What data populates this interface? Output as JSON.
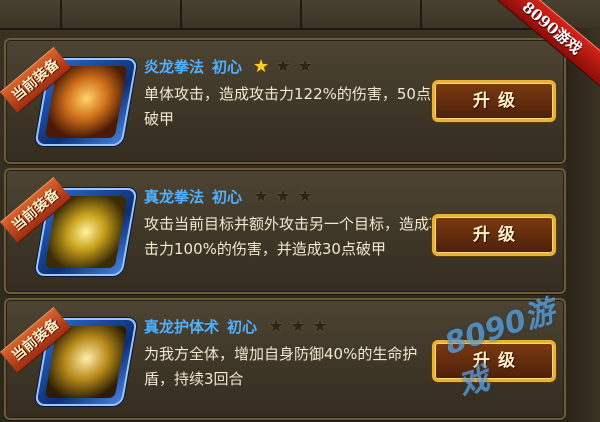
{
  "corner_banner": "8090游戏",
  "watermark": "8090游戏",
  "cards": [
    {
      "ribbon": "当前装备",
      "skill_name": "炎龙拳法",
      "grade": "初心",
      "stars_lit": 1,
      "stars_total": 3,
      "description": "单体攻击，造成攻击力122%的伤害，50点破甲",
      "button": "升级"
    },
    {
      "ribbon": "当前装备",
      "skill_name": "真龙拳法",
      "grade": "初心",
      "stars_lit": 0,
      "stars_total": 3,
      "description": "攻击当前目标并额外攻击另一个目标，造成攻击力100%的伤害，并造成30点破甲",
      "button": "升级"
    },
    {
      "ribbon": "当前装备",
      "skill_name": "真龙护体术",
      "grade": "初心",
      "stars_lit": 0,
      "stars_total": 3,
      "description": "为我方全体，增加自身防御40%的生命护盾，持续3回合",
      "button": "升级"
    }
  ],
  "colors": {
    "title": "#4fb1ff",
    "text": "#f2e7cf",
    "button_border": "#e8b235",
    "star_lit": "#ffcc2e"
  }
}
